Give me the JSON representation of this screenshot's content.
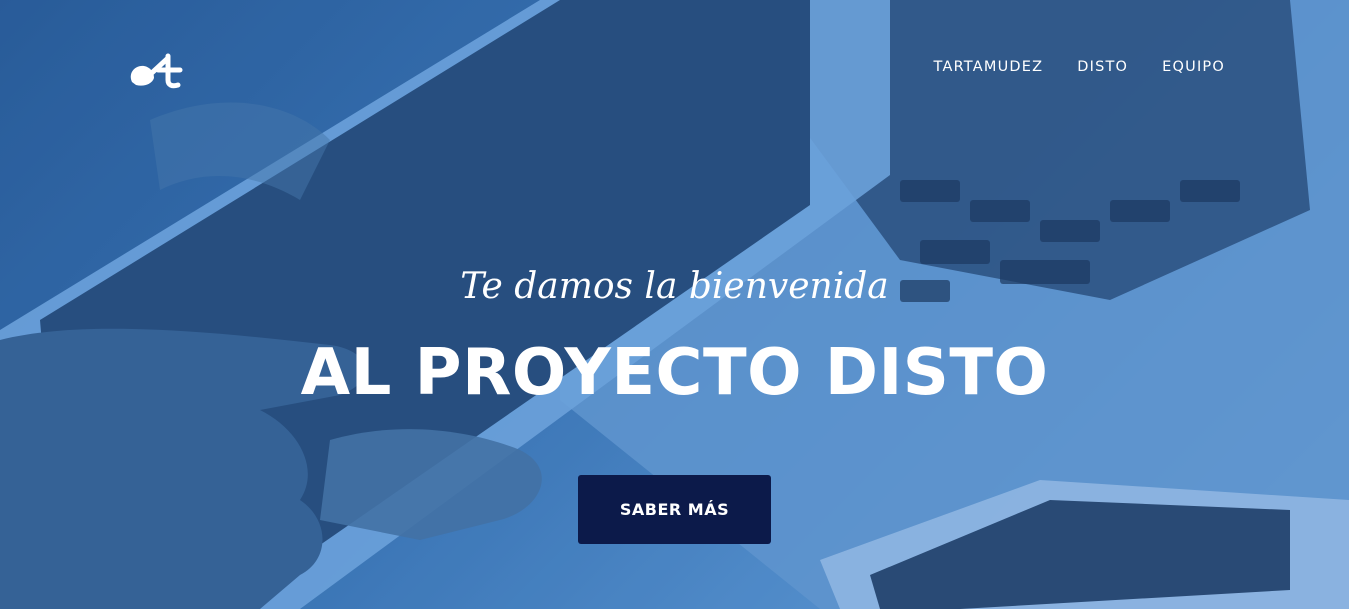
{
  "brand": {
    "logo_icon": "disto-logo-icon"
  },
  "nav": {
    "items": [
      {
        "label": "TARTAMUDEZ"
      },
      {
        "label": "DISTO"
      },
      {
        "label": "EQUIPO"
      }
    ]
  },
  "hero": {
    "subtitle": "Te damos la bienvenida",
    "title": "AL PROYECTO DISTO",
    "cta_label": "SABER MÁS",
    "background_image": "hands-tablet-laptop-phone-photo",
    "colors": {
      "tint": "#3d79b8",
      "cta_background": "#0c1a4a",
      "text": "#ffffff"
    }
  }
}
